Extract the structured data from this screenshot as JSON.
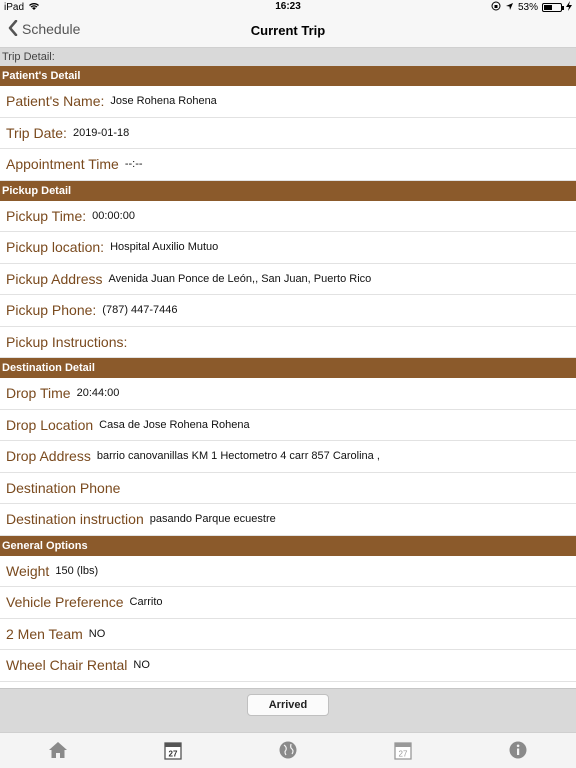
{
  "status_bar": {
    "device": "iPad",
    "time": "16:23",
    "battery": "53%",
    "battery_level": 0.53
  },
  "nav": {
    "back_label": "Schedule",
    "title": "Current Trip"
  },
  "trip_detail_label": "Trip Detail:",
  "sections": {
    "patient": {
      "header": "Patient's Detail",
      "rows": [
        {
          "label": "Patient's Name:",
          "value": "Jose Rohena Rohena"
        },
        {
          "label": "Trip Date:",
          "value": "2019-01-18"
        },
        {
          "label": "Appointment Time",
          "value": "--:--"
        }
      ]
    },
    "pickup": {
      "header": "Pickup Detail",
      "rows": [
        {
          "label": "Pickup Time:",
          "value": "00:00:00"
        },
        {
          "label": "Pickup location:",
          "value": "Hospital Auxilio Mutuo"
        },
        {
          "label": "Pickup Address",
          "value": "Avenida Juan Ponce de León,,  San Juan, Puerto Rico"
        },
        {
          "label": "Pickup Phone:",
          "value": "(787) 447-7446"
        },
        {
          "label": "Pickup Instructions:",
          "value": ""
        }
      ]
    },
    "destination": {
      "header": "Destination Detail",
      "rows": [
        {
          "label": "Drop Time",
          "value": "20:44:00"
        },
        {
          "label": "Drop Location",
          "value": "Casa de Jose Rohena Rohena"
        },
        {
          "label": "Drop Address",
          "value": "barrio canovanillas KM 1 Hectometro 4 carr 857 Carolina ,"
        },
        {
          "label": "Destination Phone",
          "value": ""
        },
        {
          "label": "Destination instruction",
          "value": "pasando Parque ecuestre"
        }
      ]
    },
    "general": {
      "header": "General Options",
      "rows": [
        {
          "label": "Weight",
          "value": "150 (lbs)"
        },
        {
          "label": "Vehicle Preference",
          "value": "Carrito"
        },
        {
          "label": "2 Men Team",
          "value": "NO"
        },
        {
          "label": "Wheel Chair Rental",
          "value": "NO"
        }
      ]
    }
  },
  "action": {
    "arrived_label": "Arrived"
  },
  "tab_bar": {
    "calendar_day": "27",
    "items": [
      {
        "icon": "home-icon"
      },
      {
        "icon": "calendar-icon"
      },
      {
        "icon": "globe-icon"
      },
      {
        "icon": "calendar-icon"
      },
      {
        "icon": "info-icon"
      }
    ]
  },
  "colors": {
    "section_header": "#8b5a2b",
    "label_text": "#7a4a1e"
  }
}
